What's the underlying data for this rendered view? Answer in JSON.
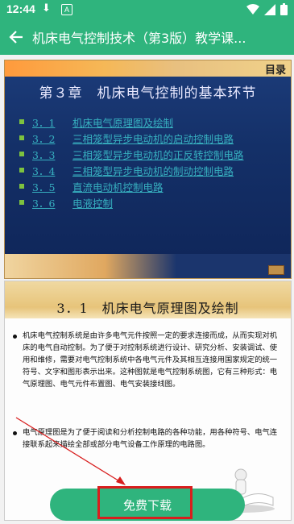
{
  "status_bar": {
    "time": "12:44"
  },
  "app_bar": {
    "title": "机床电气控制技术（第3版）教学课..."
  },
  "slide1": {
    "corner_label": "目录",
    "chapter_title": "第３章　机床电气控制的基本环节",
    "toc": [
      {
        "num": "3．1",
        "text": "机床电气原理图及绘制"
      },
      {
        "num": "3．2",
        "text": "三相笼型异步电动机的启动控制电路"
      },
      {
        "num": "3．3",
        "text": "三相笼型异步电动机的正反转控制电路"
      },
      {
        "num": "3．4",
        "text": "三相笼型异步电动机的制动控制电路"
      },
      {
        "num": "3．5",
        "text": "直流电动机控制电路"
      },
      {
        "num": "3．6",
        "text": "电液控制"
      }
    ],
    "nav_label": "返回"
  },
  "slide2": {
    "heading": "3．1　机床电气原理图及绘制",
    "bullets": [
      "机床电气控制系统是由许多电气元件按照一定的要求连接而成，从而实现对机床的电气自动控制。为了便于对控制系统进行设计、研究分析、安装调试、使用和维修，需要对电气控制系统中各电气元件及其相互连接用国家规定的统一符号、文字和图形表示出来。这种图就是电气控制系统图，它有三种形式：电气原理图、电气元件布置图、电气安装接线图。",
      "电气原理图是为了便于阅读和分析控制电路的各种功能，用各种符号、电气连接联系起来描绘全部或部分电气设备工作原理的电路图。"
    ]
  },
  "download_button": {
    "label": "免费下载"
  },
  "colors": {
    "primary": "#2fb47d",
    "annotation": "#d81e1e"
  }
}
